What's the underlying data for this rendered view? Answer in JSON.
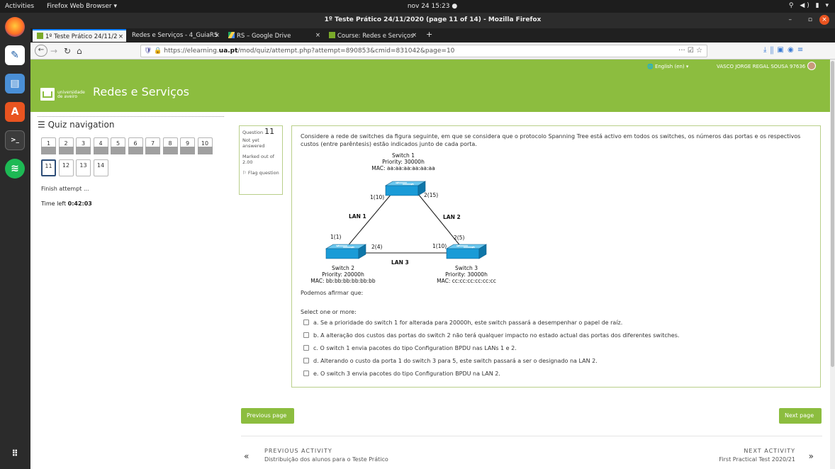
{
  "topbar": {
    "activities": "Activities",
    "app_menu": "Firefox Web Browser ▾",
    "clock": "nov 24  15:23 ●",
    "system_icons": "⚲ ◀) ▮ ▾"
  },
  "window": {
    "title": "1º Teste Prático 24/11/2020 (page 11 of 14) - Mozilla Firefox",
    "controls": "– ▫"
  },
  "tabs": [
    {
      "label": "1º Teste Prático 24/11/2",
      "close": "×"
    },
    {
      "label": "Redes e Serviços - 4_GuiaRS",
      "close": "×"
    },
    {
      "label": "RS – Google Drive",
      "close": "×"
    },
    {
      "label": "Course: Redes e Serviços",
      "close": "×"
    }
  ],
  "new_tab": "+",
  "nav": {
    "back": "←",
    "forward": "→",
    "reload": "↻",
    "home": "⌂",
    "url_prefix": "https://elearning.",
    "url_domain": "ua.pt",
    "url_suffix": "/mod/quiz/attempt.php?attempt=890853&cmid=831042&page=10",
    "url_right_icons": "··· ☑ ☆",
    "toolbar_icons": "⤓  ⫼  ▣  ◉  ≡"
  },
  "moodle": {
    "language": "🌐 English (en) ▾",
    "user": "VASCO JORGE REGAL SOUSA 97636",
    "logo_text_1": "universidade",
    "logo_text_2": "de aveiro",
    "course_title": "Redes e Serviços"
  },
  "quiz_nav": {
    "title": "Quiz navigation",
    "questions": [
      "1",
      "2",
      "3",
      "4",
      "5",
      "6",
      "7",
      "8",
      "9",
      "10",
      "11",
      "12",
      "13",
      "14"
    ],
    "current": 11,
    "finish": "Finish attempt ...",
    "time_left_label": "Time left",
    "time_left_value": "0:42:03"
  },
  "question_info": {
    "label": "Question",
    "number": "11",
    "status": "Not yet answered",
    "marked_out_of": "Marked out of 2.00",
    "flag": "⚐ Flag question"
  },
  "question": {
    "text": "Considere a rede de switches da figura seguinte, em que se considera que o protocolo Spanning Tree está activo em todos os switches, os números das portas e os respectivos custos (entre parêntesis) estão indicados junto de cada porta.",
    "diagram": {
      "switch1": {
        "name": "Switch 1",
        "priority": "Priority: 30000h",
        "mac": "MAC: aa:aa:aa:aa:aa:aa"
      },
      "switch2": {
        "name": "Switch 2",
        "priority": "Priority: 20000h",
        "mac": "MAC: bb:bb:bb:bb:bb:bb"
      },
      "switch3": {
        "name": "Switch 3",
        "priority": "Priority: 30000h",
        "mac": "MAC: cc:cc:cc:cc:cc:cc"
      },
      "ports": {
        "s1p1": "1(10)",
        "s1p2": "2(15)",
        "s2p1": "1(1)",
        "s2p2": "2(4)",
        "s3p1": "1(10)",
        "s3p2": "2(5)"
      },
      "lan1": "LAN 1",
      "lan2": "LAN 2",
      "lan3": "LAN 3"
    },
    "podemos": "Podemos afirmar que:",
    "select": "Select one or more:",
    "options": [
      "a. Se a prioridade do switch 1 for alterada para 20000h, este switch passará a desempenhar o papel de raíz.",
      "b. A alteração dos custos das portas do switch 2 não terá qualquer impacto no estado actual das portas dos diferentes switches.",
      "c. O switch 1 envia pacotes do tipo Configuration BPDU nas LANs 1 e 2.",
      "d. Alterando o custo da porta 1 do switch 3 para 5, este switch passará a ser o designado na LAN 2.",
      "e. O switch 3 envia pacotes do tipo Configuration BPDU na LAN 2."
    ]
  },
  "buttons": {
    "previous_page": "Previous page",
    "next_page": "Next page"
  },
  "activity_nav": {
    "prev_label": "PREVIOUS ACTIVITY",
    "prev_name": "Distribuição dos alunos para o Teste Prático",
    "next_label": "NEXT ACTIVITY",
    "next_name": "First Practical Test 2020/21",
    "prev_arrow": "«",
    "next_arrow": "»"
  },
  "colors": {
    "moodle_green": "#8cbd3f",
    "switch_blue": "#1a9bd7",
    "firefox_orange": "#e95420"
  }
}
